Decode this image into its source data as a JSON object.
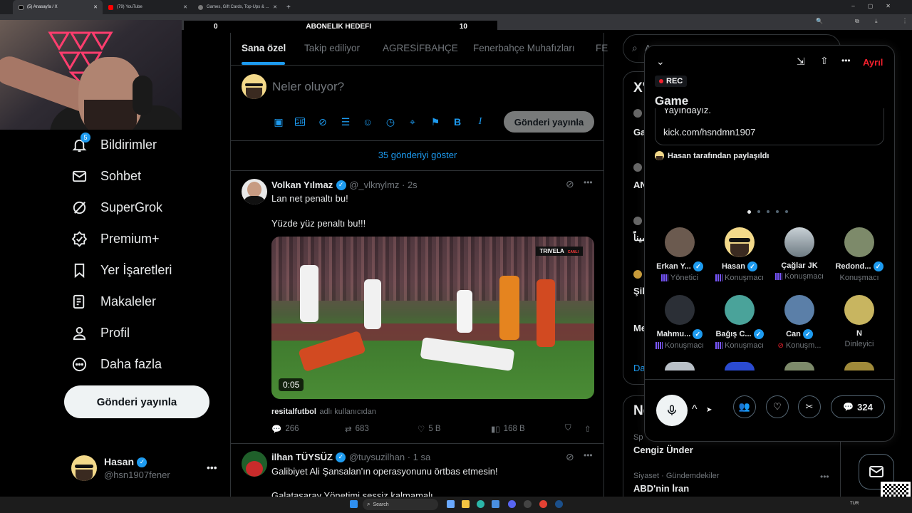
{
  "browser": {
    "tabs": [
      {
        "label": "(5) Anasayfa / X",
        "color": "#000000"
      },
      {
        "label": "(79) YouTube",
        "color": "#ff0000"
      },
      {
        "label": "Games, Gift Cards, Top-Ups & ...",
        "color": "#7a7a7a"
      }
    ],
    "new_tab": "+"
  },
  "overlay": {
    "goal_left": "0",
    "goal_title": "ABONELIK HEDEFI",
    "goal_right": "10"
  },
  "sidebar": {
    "items": [
      {
        "label": "Bildirimler",
        "icon": "bell-icon",
        "badge": "5"
      },
      {
        "label": "Sohbet",
        "icon": "mail-icon"
      },
      {
        "label": "SuperGrok",
        "icon": "grok-icon"
      },
      {
        "label": "Premium+",
        "icon": "premium-icon"
      },
      {
        "label": "Yer İşaretleri",
        "icon": "bookmark-icon"
      },
      {
        "label": "Makaleler",
        "icon": "articles-icon"
      },
      {
        "label": "Profil",
        "icon": "person-icon"
      },
      {
        "label": "Daha fazla",
        "icon": "more-circle-icon"
      }
    ],
    "post_button": "Gönderi yayınla",
    "account": {
      "name": "Hasan",
      "handle": "@hsn1907fener"
    }
  },
  "feed": {
    "tabs": [
      "Sana özel",
      "Takip ediliyor",
      "AGRESİFBAHÇE",
      "Fenerbahçe Muhafızları",
      "FE"
    ],
    "composer_placeholder": "Neler oluyor?",
    "composer_button": "Gönderi yayınla",
    "show_more": "35 gönderiyi göster",
    "tweets": [
      {
        "name": "Volkan Yılmaz",
        "handle": "@_vlknylmz · 2s",
        "line1": "Lan net penaltı bu!",
        "line2": "Yüzde yüz penaltı bu!!!",
        "video_time": "0:05",
        "broadcast_tag": "TRIVELA",
        "broadcast_live": "CANLI",
        "source_name": "resitalfutbol",
        "source_suffix": "adlı kullanıcıdan",
        "replies": "266",
        "reposts": "683",
        "likes": "5 B",
        "views": "168 B"
      },
      {
        "name": "ilhan TÜYSÜZ",
        "handle": "@tuysuzilhan · 1 sa",
        "line1": "Galibiyet Ali Şansalan'ın operasyonunu örtbas etmesin!",
        "line2": "Galatasaray Yönetimi sessiz kalmamalı"
      }
    ]
  },
  "right": {
    "search_placeholder": "A",
    "card1": {
      "title": "X'",
      "rows": [
        "Ga",
        "AN",
        "ميناً",
        "Şil",
        "Me"
      ],
      "footer": "Da"
    },
    "card2": {
      "title": "Ne",
      "trend1_cat": "Sp",
      "trend1_name": "Cengiz Ünder",
      "trend2_cat": "Siyaset · Gündemdekiler",
      "trend2_name": "ABD'nin İran"
    }
  },
  "space": {
    "leave": "Ayrıl",
    "rec": "REC",
    "title": "Game",
    "pinned_text1": "Yayındayız.",
    "pinned_text2": "kick.com/hsndmn1907",
    "shared_by": "Hasan tarafından paylaşıldı",
    "people": [
      {
        "name": "Erkan Y...",
        "role": "Yönetici",
        "verified": true,
        "bars": true,
        "color": "#6b5a4f"
      },
      {
        "name": "Hasan",
        "role": "Konuşmacı",
        "verified": true,
        "bars": true,
        "color": "#f3d98a"
      },
      {
        "name": "Çağlar JK",
        "role": "Konuşmacı",
        "verified": false,
        "bars": true,
        "color": "#9aa6ad"
      },
      {
        "name": "Redond...",
        "role": "Konuşmacı",
        "verified": true,
        "bars": false,
        "color": "#7d8a6a"
      },
      {
        "name": "Mahmu...",
        "role": "Konuşmacı",
        "verified": true,
        "bars": true,
        "color": "#2b2f36"
      },
      {
        "name": "Bağış C...",
        "role": "Konuşmacı",
        "verified": true,
        "bars": true,
        "color": "#4aa39a"
      },
      {
        "name": "Can",
        "role": "Konuşm...",
        "verified": true,
        "bars": false,
        "muted": true,
        "color": "#5b7fa8"
      },
      {
        "name": "N",
        "role": "Dinleyici",
        "verified": false,
        "bars": false,
        "color": "#c8b560"
      }
    ],
    "comments_count": "324"
  },
  "taskbar": {
    "search_placeholder": "Search",
    "lang": "TUR"
  }
}
